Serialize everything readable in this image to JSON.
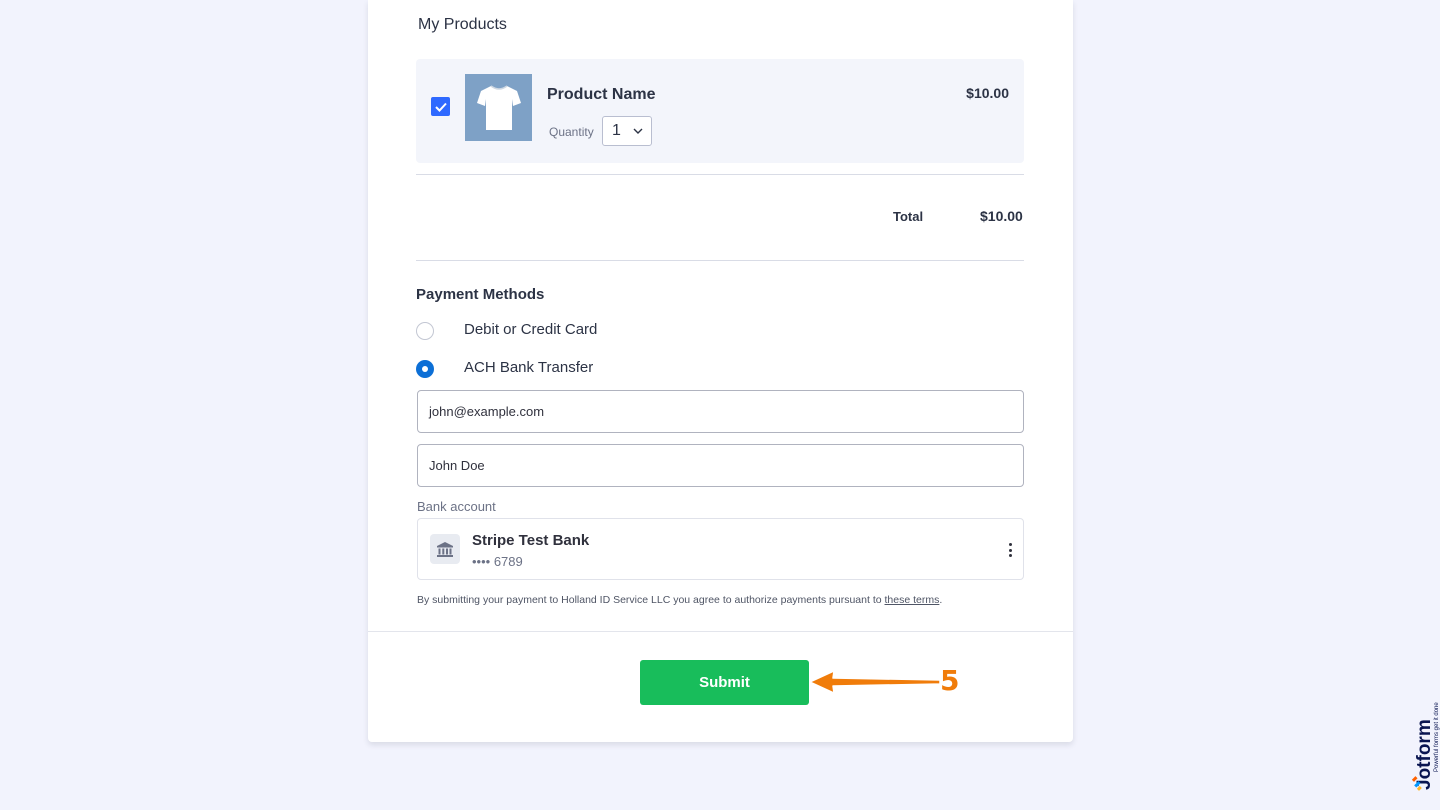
{
  "products": {
    "section_title": "My Products",
    "items": [
      {
        "name": "Product Name",
        "quantity_label": "Quantity",
        "quantity": "1",
        "price": "$10.00",
        "checked": true
      }
    ],
    "total_label": "Total",
    "total_value": "$10.00"
  },
  "payment": {
    "title": "Payment Methods",
    "options": [
      {
        "label": "Debit or Credit Card",
        "selected": false
      },
      {
        "label": "ACH Bank Transfer",
        "selected": true
      }
    ],
    "email_value": "john@example.com",
    "name_value": "John Doe",
    "bank_label": "Bank account",
    "bank_name": "Stripe Test Bank",
    "bank_account": "•••• 6789",
    "terms_text": "By submitting your payment to Holland ID Service LLC you agree to authorize payments pursuant to",
    "terms_link": "these terms",
    "terms_end": "."
  },
  "submit_label": "Submit",
  "annotation_number": "5",
  "branding": {
    "name": "Jotform",
    "tagline": "Powerful forms get it done"
  },
  "colors": {
    "accent": "#2e69ff",
    "radio_selected": "#0c6fd6",
    "submit": "#18bd5b",
    "annotation": "#f07c0a",
    "background": "#f2f3fd"
  }
}
